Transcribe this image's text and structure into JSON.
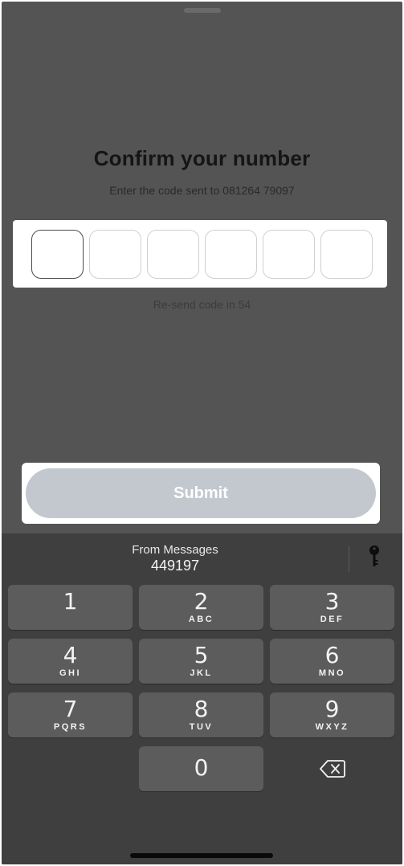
{
  "header": {
    "title": "Confirm your number",
    "subtitle": "Enter the code sent to 081264 79097"
  },
  "code_input": {
    "length": 6,
    "digits": [
      "",
      "",
      "",
      "",
      "",
      ""
    ],
    "active_index": 0
  },
  "resend": {
    "label": "Re-send code in 54"
  },
  "submit": {
    "label": "Submit",
    "enabled": false
  },
  "keyboard": {
    "suggestion": {
      "source_label": "From Messages",
      "code": "449197"
    },
    "keys": [
      {
        "digit": "1",
        "letters": ""
      },
      {
        "digit": "2",
        "letters": "ABC"
      },
      {
        "digit": "3",
        "letters": "DEF"
      },
      {
        "digit": "4",
        "letters": "GHI"
      },
      {
        "digit": "5",
        "letters": "JKL"
      },
      {
        "digit": "6",
        "letters": "MNO"
      },
      {
        "digit": "7",
        "letters": "PQRS"
      },
      {
        "digit": "8",
        "letters": "TUV"
      },
      {
        "digit": "9",
        "letters": "WXYZ"
      },
      {
        "digit": "0",
        "letters": ""
      }
    ]
  },
  "colors": {
    "overlay_background": "#545454",
    "keyboard_background": "#3f3f3f",
    "key_background": "#5c5c5c",
    "submit_disabled": "#c3c8cf"
  }
}
